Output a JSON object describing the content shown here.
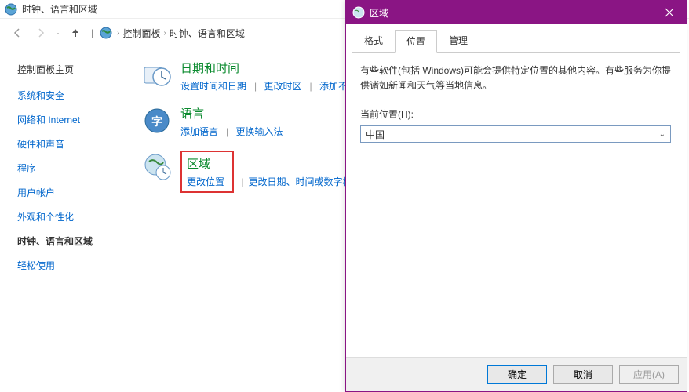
{
  "cp": {
    "title": "时钟、语言和区域",
    "breadcrumb": {
      "root": "控制面板",
      "current": "时钟、语言和区域"
    },
    "sidebar": {
      "home": "控制面板主页",
      "items": [
        {
          "label": "系统和安全"
        },
        {
          "label": "网络和 Internet"
        },
        {
          "label": "硬件和声音"
        },
        {
          "label": "程序"
        },
        {
          "label": "用户帐户"
        },
        {
          "label": "外观和个性化"
        },
        {
          "label": "时钟、语言和区域",
          "active": true
        },
        {
          "label": "轻松使用"
        }
      ]
    },
    "categories": [
      {
        "title": "日期和时间",
        "links": [
          "设置时间和日期",
          "更改时区",
          "添加不同时区的"
        ]
      },
      {
        "title": "语言",
        "links": [
          "添加语言",
          "更换输入法"
        ]
      },
      {
        "title": "区域",
        "links": [
          "更改位置",
          "更改日期、时间或数字格式"
        ],
        "highlight": true
      }
    ]
  },
  "dialog": {
    "title": "区域",
    "tabs": [
      "格式",
      "位置",
      "管理"
    ],
    "active_tab": 1,
    "description": "有些软件(包括 Windows)可能会提供特定位置的其他内容。有些服务为你提供诸如新闻和天气等当地信息。",
    "location_label": "当前位置(H):",
    "location_value": "中国",
    "buttons": {
      "ok": "确定",
      "cancel": "取消",
      "apply": "应用(A)"
    }
  }
}
